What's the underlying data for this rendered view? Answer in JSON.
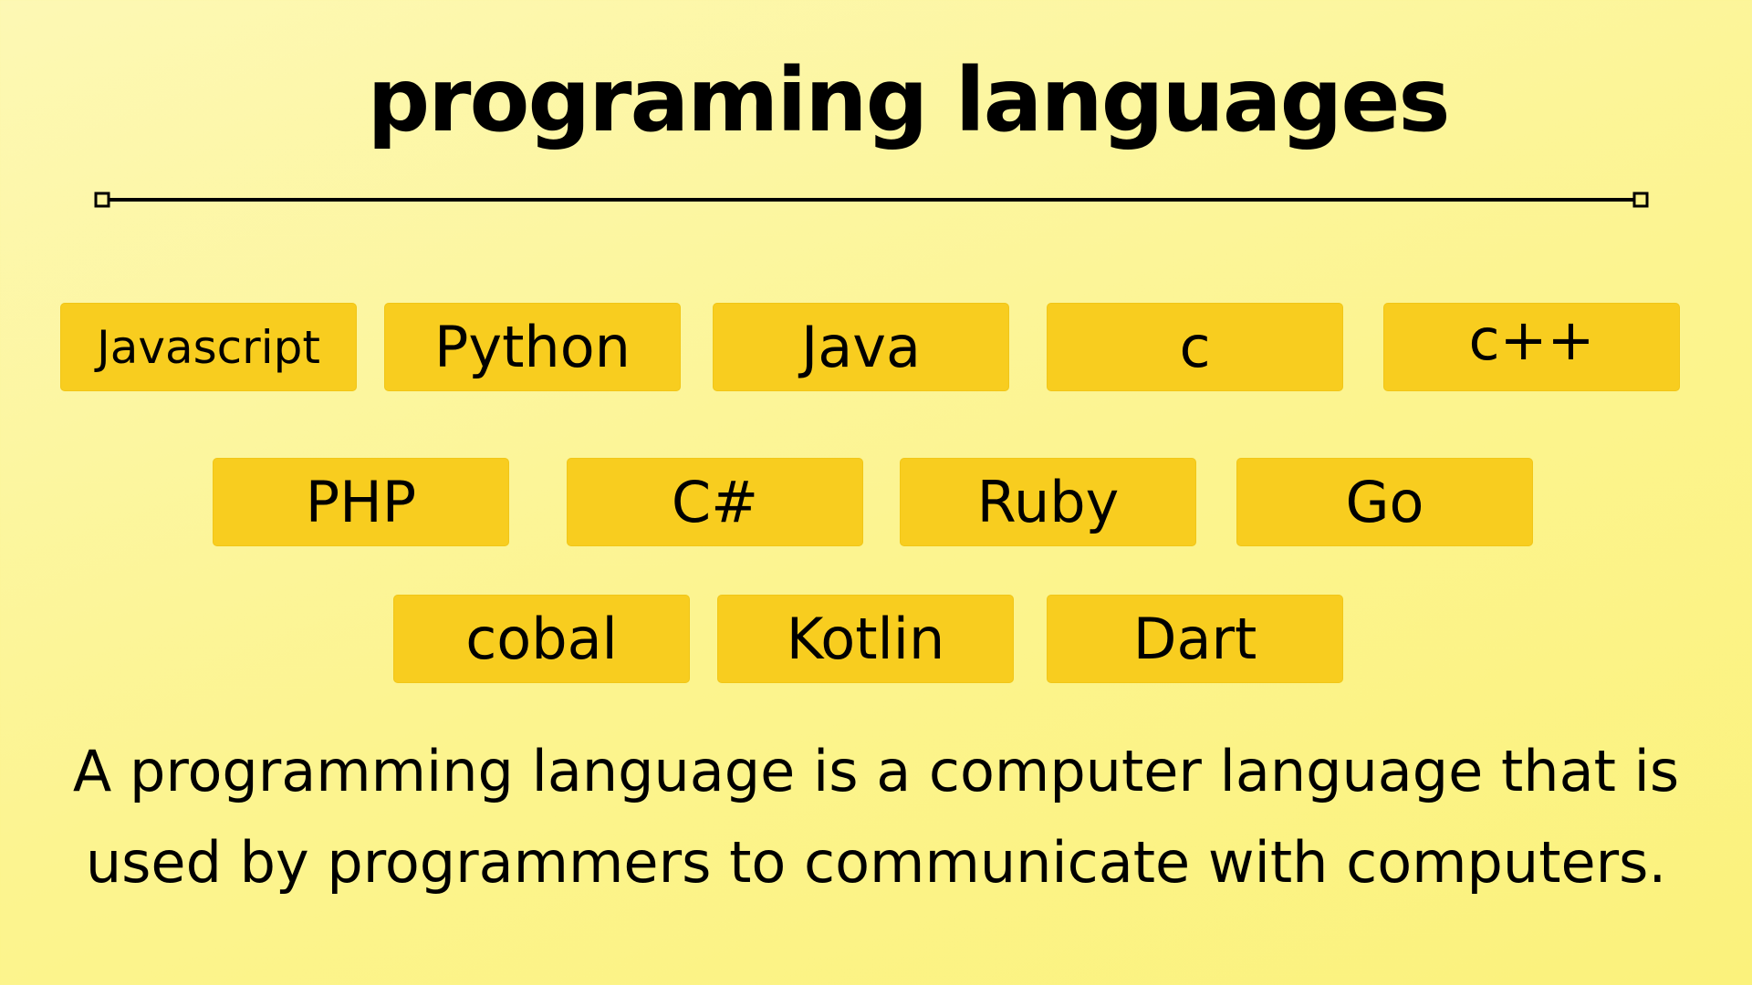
{
  "title": "programing languages",
  "languages": {
    "row1": [
      "Javascript",
      "Python",
      "Java",
      "c",
      "c++"
    ],
    "row2": [
      "PHP",
      "C#",
      "Ruby",
      "Go"
    ],
    "row3": [
      "cobal",
      "Kotlin",
      "Dart"
    ]
  },
  "description": {
    "line1": "A programming language is a computer language that is",
    "line2": "used by programmers to communicate with computers."
  },
  "colors": {
    "background": "#fcf48f",
    "chip": "#f8cd1f",
    "text": "#000000"
  }
}
